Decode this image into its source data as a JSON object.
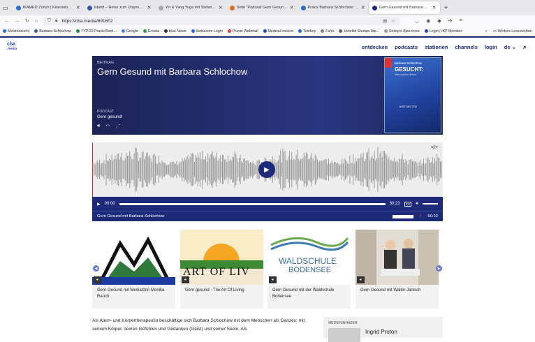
{
  "browser": {
    "tabs": [
      {
        "label": "IKAMED Zürich | Kinesiologie, 1:",
        "color": "#2b6cd6"
      },
      {
        "label": "Island – Reise zum Ursprung de",
        "color": "#3a5a9a"
      },
      {
        "label": "Yin & Yang Yoga mit Stefania Maria",
        "color": "#aaaaaa"
      },
      {
        "label": "Seite \"Podcast Gern Gesund in",
        "color": "#e07020"
      },
      {
        "label": "Praxis Barbara Schlochow: Pub",
        "color": "#2b6cd6"
      },
      {
        "label": "Gern Gesund mit Barbara Schlo",
        "color": "#1d2a7a",
        "active": true
      }
    ],
    "url": "https://cba.media/691602",
    "bookmarks": [
      "Meistbesucht",
      "Barbara Schlochow",
      "TYPO3 Praxis Barb...",
      "Google",
      "Ecosia",
      "blue News",
      "Swisscom Login",
      "Praxis Webmail",
      "Medical Invoice",
      "Teleboy",
      "FaYo",
      "Hotelkit Stumps Alp...",
      "Stump's Alpenrose",
      "Login | IKP Member"
    ],
    "more_bookmarks": "Weitere Lesezeichen"
  },
  "site": {
    "logo_main": "cba",
    "logo_sub": ".media",
    "nav": [
      "entdecken",
      "podcasts",
      "stationen",
      "channels",
      "login",
      "de"
    ]
  },
  "hero": {
    "kicker": "BEITRAG",
    "title": "Gern Gesund mit Barbara Schlochow",
    "podcast_label": "PODCAST",
    "podcast_name": "Gern gesund!",
    "cover": {
      "author": "Barbara Schlochow",
      "title": "GESUCHT:",
      "subtitle": "Mein wahres Selbst",
      "text": "LEBE DAS TOD"
    }
  },
  "player": {
    "current_time": "00:00",
    "duration": "60:22",
    "cc": "CC",
    "info_title": "Gern Gesund mit Barbara Schlochow",
    "info_duration": "60:22",
    "progress": 0
  },
  "related": [
    {
      "title": "Gern Gesund mit Mediatorin Monika Rauch"
    },
    {
      "title": "Gern gesund - The Art Of Living",
      "thumb_text": "ART OF LIV"
    },
    {
      "title": "Gern Gesund mit der Waldschule Bodensee",
      "thumb_text1": "WALDSCHULE",
      "thumb_text2": "BODENSEE"
    },
    {
      "title": "Gern Gesund mit Walter Janisch"
    }
  ],
  "description": "Als Atem- und Körpertherapeutin beschäftige sich Barbara Schlochow mit dem Menschen als Ganzes: mit seinem Körper, seinen Gefühlen und Gedanken (Geist) und seiner Seele. Als",
  "sidebar": {
    "label": "MEDIENINHABER",
    "name": "Ingrid Proton"
  },
  "colors": {
    "brand": "#1d2a7a",
    "accent": "#2a3da8"
  }
}
